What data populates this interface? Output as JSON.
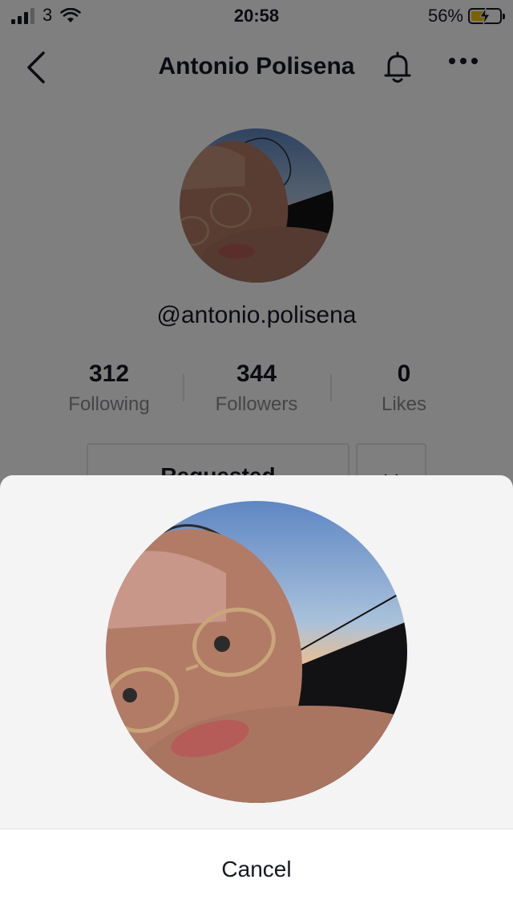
{
  "status_bar": {
    "carrier": "3",
    "time": "20:58",
    "battery": "56%",
    "battery_level": 0.56
  },
  "header": {
    "title": "Antonio Polisena",
    "icons": [
      "back-chevron-icon",
      "bell-icon",
      "more-icon"
    ]
  },
  "profile": {
    "handle": "@antonio.polisena",
    "stats": [
      {
        "value": "312",
        "label": "Following"
      },
      {
        "value": "344",
        "label": "Followers"
      },
      {
        "value": "0",
        "label": "Likes"
      }
    ],
    "requested_button": "Requested"
  },
  "sheet": {
    "cancel_label": "Cancel"
  },
  "colors": {
    "text": "#161823",
    "muted": "#8a8b91",
    "sheet_bg": "#f4f4f5",
    "overlay": "rgba(0,0,0,0.5)",
    "battery_fill": "#f5c400"
  }
}
